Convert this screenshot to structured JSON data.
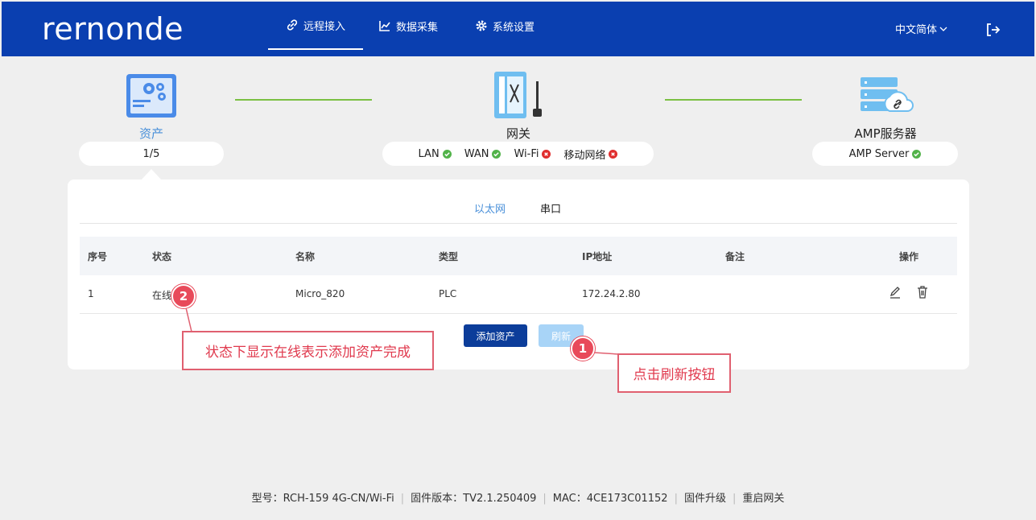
{
  "header": {
    "logo": "rernonde",
    "nav": [
      {
        "label": "远程接入",
        "icon": "link-icon"
      },
      {
        "label": "数据采集",
        "icon": "chart-icon"
      },
      {
        "label": "系统设置",
        "icon": "gear-icon"
      }
    ],
    "language": "中文简体",
    "logout_icon": "logout-icon"
  },
  "topology": {
    "asset": {
      "label": "资产",
      "count": "1/5"
    },
    "gateway": {
      "label": "网关",
      "statuses": [
        {
          "name": "LAN",
          "ok": true
        },
        {
          "name": "WAN",
          "ok": true
        },
        {
          "name": "Wi-Fi",
          "ok": false
        },
        {
          "name": "移动网络",
          "ok": false
        }
      ]
    },
    "server": {
      "label": "AMP服务器",
      "status": "AMP Server",
      "ok": true
    }
  },
  "tabs": [
    "以太网",
    "串口"
  ],
  "table": {
    "headers": [
      "序号",
      "状态",
      "名称",
      "类型",
      "IP地址",
      "备注",
      "操作"
    ],
    "rows": [
      {
        "index": "1",
        "status": "在线",
        "name": "Micro_820",
        "type": "PLC",
        "ip": "172.24.2.80",
        "note": ""
      }
    ]
  },
  "buttons": {
    "add_asset": "添加资产",
    "refresh": "刷新"
  },
  "annotations": {
    "badge_1": "1",
    "badge_2": "2",
    "text_1": "点击刷新按钮",
    "text_2": "状态下显示在线表示添加资产完成"
  },
  "footer": {
    "model": "型号：RCH-159  4G-CN/Wi-Fi",
    "firmware": "固件版本：TV2.1.250409",
    "mac": "MAC：4CE173C01152",
    "upgrade": "固件升级",
    "reboot": "重启网关"
  },
  "colors": {
    "header": "#0a3fb0",
    "accent": "#4a90d9",
    "ok": "#52b34a",
    "error": "#e02e2e",
    "annotation": "#e84a5a"
  }
}
